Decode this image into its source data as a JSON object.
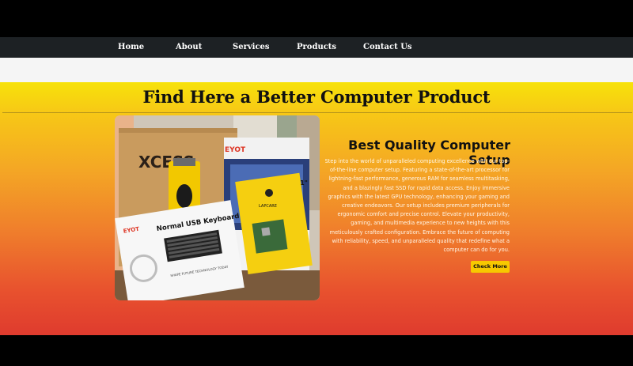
{
  "nav": {
    "items": [
      {
        "label": "Home"
      },
      {
        "label": "About"
      },
      {
        "label": "Services"
      },
      {
        "label": "Products"
      },
      {
        "label": "Contact Us"
      }
    ]
  },
  "hero": {
    "title": "Find Here a Better Computer Product"
  },
  "feature": {
    "heading": "Best Quality Computer Setup",
    "description": "Step into the world of unparalleled computing excellence with our top-of-the-line computer setup. Featuring a state-of-the-art processor for lightning-fast performance, generous RAM for seamless multitasking, and a blazingly fast SSD for rapid data access. Enjoy immersive graphics with the latest GPU technology, enhancing your gaming and creative endeavors. Our setup includes premium peripherals for ergonomic comfort and precise control. Elevate your productivity, gaming, and multimedia experience to new heights with this meticulously crafted configuration. Embrace the future of computing with reliability, speed, and unparalleled quality that redefine what a computer can do for you.",
    "button_label": "Check More"
  },
  "photo": {
    "box_brand": "XCESS",
    "brand": "EYOT",
    "keyboard_label": "Normal USB Keyboard",
    "keyboard_tagline": "SHAPE FUTURE TECHNOLOGY TODAY",
    "monitor_size": "15.1\"",
    "motherboard_brand": "LAPCARE"
  },
  "colors": {
    "nav_bg": "#1d2124",
    "button_bg": "#f7c800",
    "gradient_top": "#f7e20a",
    "gradient_bottom": "#df3b2e"
  }
}
